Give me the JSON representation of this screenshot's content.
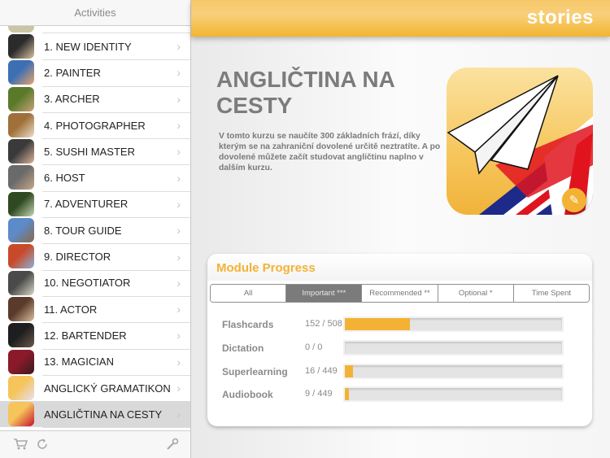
{
  "sidebar": {
    "title": "Activities",
    "items": [
      {
        "label": "1. NEW IDENTITY",
        "thumb": [
          "#2b2b2b",
          "#d9c2a0"
        ]
      },
      {
        "label": "2. PAINTER",
        "thumb": [
          "#3d6fb3",
          "#e8a46b"
        ]
      },
      {
        "label": "3. ARCHER",
        "thumb": [
          "#5a7a2a",
          "#c9a27a"
        ]
      },
      {
        "label": "4. PHOTOGRAPHER",
        "thumb": [
          "#a0703a",
          "#eae0cc"
        ]
      },
      {
        "label": "5. SUSHI MASTER",
        "thumb": [
          "#3a3a3a",
          "#d9b49a"
        ]
      },
      {
        "label": "6. HOST",
        "thumb": [
          "#6a6a6a",
          "#c8a88a"
        ]
      },
      {
        "label": "7. ADVENTURER",
        "thumb": [
          "#2f4a22",
          "#c8d6b8"
        ]
      },
      {
        "label": "8. TOUR GUIDE",
        "thumb": [
          "#5d8ac8",
          "#8a6a4a"
        ]
      },
      {
        "label": "9. DIRECTOR",
        "thumb": [
          "#c84a2a",
          "#8ab4d8"
        ]
      },
      {
        "label": "10. NEGOTIATOR",
        "thumb": [
          "#4a4a4a",
          "#d8d8c8"
        ]
      },
      {
        "label": "11. ACTOR",
        "thumb": [
          "#5a3a2a",
          "#d8c0a0"
        ]
      },
      {
        "label": "12. BARTENDER",
        "thumb": [
          "#1e1e1e",
          "#6a5a4a"
        ]
      },
      {
        "label": "13. MAGICIAN",
        "thumb": [
          "#8a1a2a",
          "#3a1a1a"
        ]
      },
      {
        "label": "ANGLICKÝ GRAMATIKON",
        "thumb": [
          "#f5c45a",
          "#e8e0f0"
        ]
      },
      {
        "label": "ANGLIČTINA NA CESTY",
        "thumb": [
          "#f5c45a",
          "#c8102e"
        ],
        "selected": true
      }
    ],
    "chevron": "›",
    "footer": {
      "cart_icon": "cart-icon",
      "refresh_icon": "refresh-icon",
      "settings_icon": "wrench-icon"
    }
  },
  "header": {
    "brand": "stories"
  },
  "course": {
    "title": "ANGLIČTINA NA CESTY",
    "description": "V tomto kurzu se naučíte 300 základních frází, díky kterým se na zahraniční dovolené určitě neztratíte. A po dovolené můžete začít studovat angličtinu naplno v dalším kurzu.",
    "edit_icon": "edit-icon"
  },
  "progress": {
    "title": "Module Progress",
    "tabs": [
      {
        "label": "All"
      },
      {
        "label": "Important ***",
        "active": true
      },
      {
        "label": "Recommended **"
      },
      {
        "label": "Optional *"
      },
      {
        "label": "Time Spent"
      }
    ],
    "rows": [
      {
        "name": "Flashcards",
        "value": "152 / 508",
        "done": 152,
        "total": 508
      },
      {
        "name": "Dictation",
        "value": "0 / 0",
        "done": 0,
        "total": 0
      },
      {
        "name": "Superlearning",
        "value": "16 / 449",
        "done": 16,
        "total": 449
      },
      {
        "name": "Audiobook",
        "value": "9 / 449",
        "done": 9,
        "total": 449
      }
    ]
  },
  "colors": {
    "accent": "#f4b234",
    "selected_row": "#d9d9d9"
  }
}
